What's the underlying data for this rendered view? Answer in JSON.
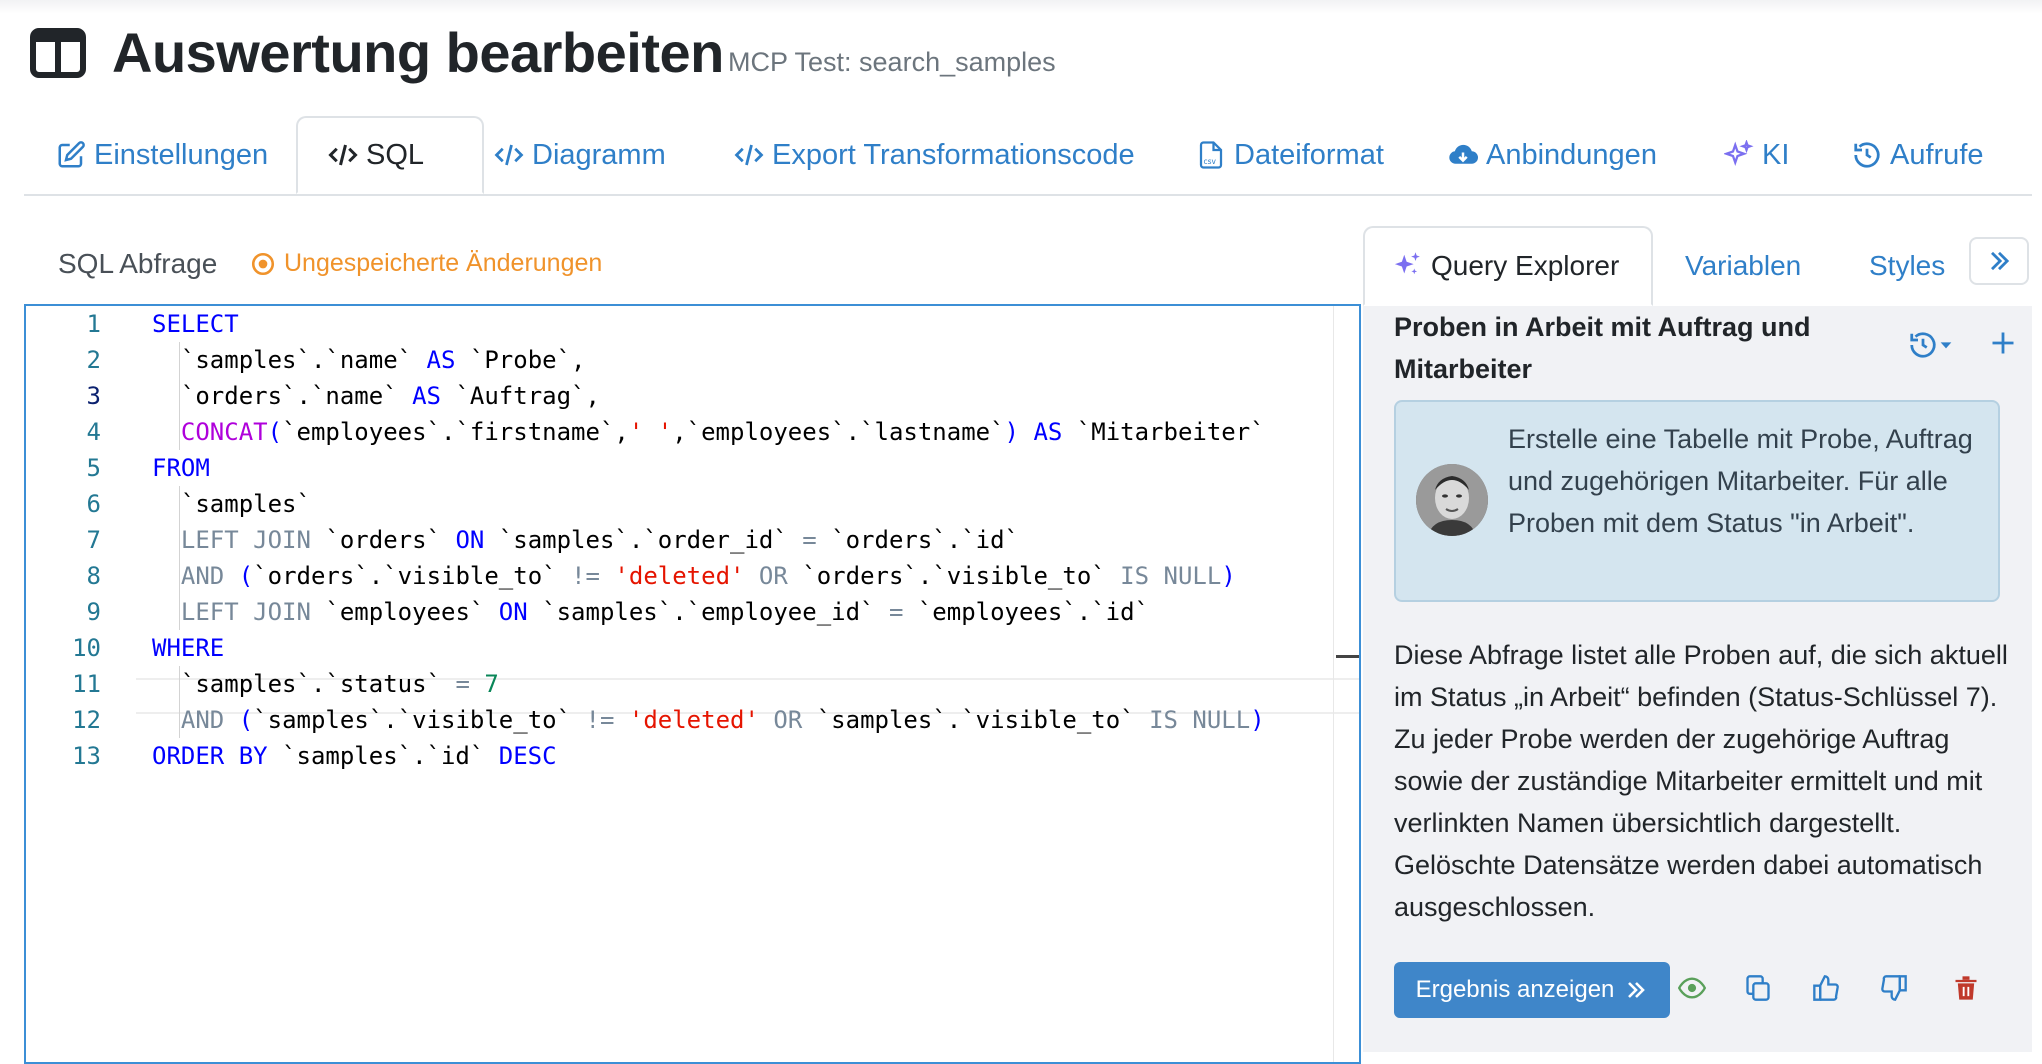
{
  "header": {
    "title": "Auswertung bearbeiten",
    "subtitle": "MCP Test: search_samples",
    "icon": "columns-icon"
  },
  "tabs": [
    {
      "label": "Einstellungen",
      "icon": "edit-icon"
    },
    {
      "label": "SQL",
      "icon": "code-icon"
    },
    {
      "label": "Diagramm",
      "icon": "code-icon"
    },
    {
      "label": "Export Transformationscode",
      "icon": "code-icon"
    },
    {
      "label": "Dateiformat",
      "icon": "csv-file-icon"
    },
    {
      "label": "Anbindungen",
      "icon": "cloud-download-icon"
    },
    {
      "label": "KI",
      "icon": "sparkles-icon"
    },
    {
      "label": "Aufrufe",
      "icon": "history-icon"
    }
  ],
  "active_tab": "SQL",
  "editor": {
    "label": "SQL Abfrage",
    "unsaved": "Ungespeicherte Änderungen",
    "line_numbers": [
      "1",
      "2",
      "3",
      "4",
      "5",
      "6",
      "7",
      "8",
      "9",
      "10",
      "11",
      "12",
      "13"
    ]
  },
  "right_panel": {
    "tabs": [
      "Query Explorer",
      "Variablen",
      "Styles"
    ],
    "query_title": "Proben in Arbeit mit Auftrag und Mitarbeiter",
    "prompt": "Erstelle eine Tabelle mit Probe, Auftrag und zugehörigen Mitarbeiter. Für alle Proben mit dem Status \"in Arbeit\".",
    "description": "Diese Abfrage listet alle Proben auf, die sich aktuell im Status „in Arbeit“ befinden (Status-Schlüssel 7). Zu jeder Probe werden der zugehörige Auftrag sowie der zuständige Mitarbeiter ermittelt und mit verlinkten Namen übersichtlich dargestellt. Gelöschte Datensätze werden dabei automatisch ausgeschlossen.",
    "result_button": "Ergebnis anzeigen"
  },
  "colors": {
    "accent": "#2f7fc8",
    "unsaved": "#f0932b",
    "prompt_bg": "#d4e5ef",
    "delete": "#c0392b",
    "view": "#5aa05a"
  }
}
